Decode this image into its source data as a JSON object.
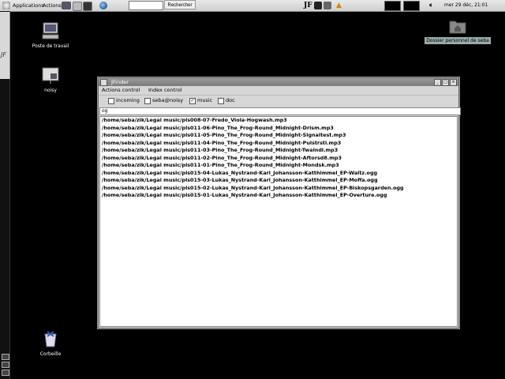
{
  "top_panel": {
    "applications": "Applications",
    "actions": "Actions",
    "search_button": "Rechercher",
    "search_value": "",
    "keyboard_layout": "JF",
    "clock": "mer 29 déc, 21:01"
  },
  "desktop": {
    "icons": [
      {
        "label": "Poste de travail"
      },
      {
        "label": "noisy"
      },
      {
        "label": "Corbeille"
      },
      {
        "label": "Dossier personnel de seba"
      }
    ]
  },
  "window": {
    "title": "JFinder",
    "menus": [
      "Actions control",
      "Index control"
    ],
    "filters": [
      {
        "label": "incoming",
        "checked": false
      },
      {
        "label": "seba@noisy",
        "checked": false
      },
      {
        "label": "music",
        "checked": true
      },
      {
        "label": "doc",
        "checked": false
      }
    ],
    "query": "og",
    "results": [
      "/home/seba/zik/Legal music/pls008-07-Fredo_Viola-Hogwash.mp3",
      "/home/seba/zik/Legal music/pls011-06-Pino_The_Frog-Round_Midnight-Drism.mp3",
      "/home/seba/zik/Legal music/pls011-05-Pino_The_Frog-Round_Midnight-Signaltest.mp3",
      "/home/seba/zik/Legal music/pls011-04-Pino_The_Frog-Round_Midnight-Pulstrstl.mp3",
      "/home/seba/zik/Legal music/pls011-03-Pino_The_Frog-Round_Midnight-Twaindl.mp3",
      "/home/seba/zik/Legal music/pls011-02-Pino_The_Frog-Round_Midnight-Aftorsd8.mp3",
      "/home/seba/zik/Legal music/pls011-01-Pino_The_Frog-Round_Midnight-Mondsk.mp3",
      "/home/seba/zik/Legal music/pls015-04-Lukas_Nystrand-Karl_Johansson-Katthimmel_EP-Waltz.ogg",
      "/home/seba/zik/Legal music/pls015-03-Lukas_Nystrand-Karl_Johansson-Katthimmel_EP-Moffa.ogg",
      "/home/seba/zik/Legal music/pls015-02-Lukas_Nystrand-Karl_Johansson-Katthimmel_EP-Biskopsgarden.ogg",
      "/home/seba/zik/Legal music/pls015-01-Lukas_Nystrand-Karl_Johansson-Katthimmel_EP-Overture.ogg"
    ]
  }
}
